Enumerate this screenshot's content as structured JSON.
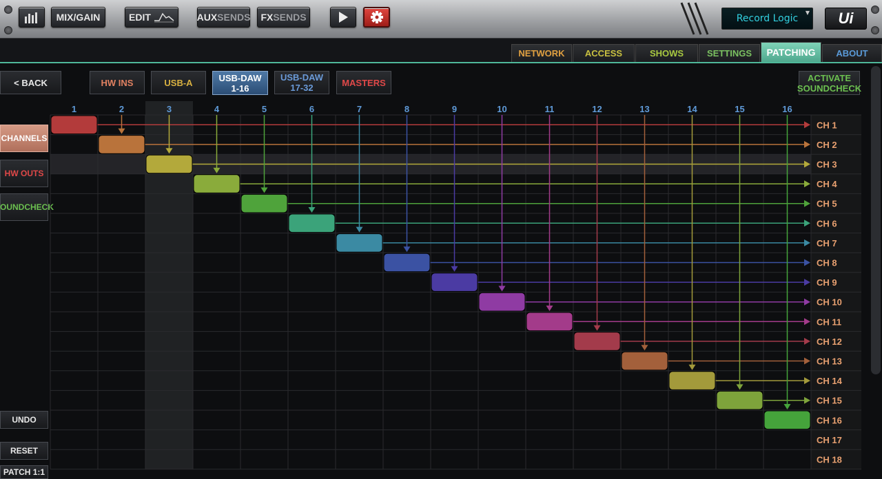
{
  "toolbar": {
    "meters_icon": "bar-meter-icon",
    "mixgain": "MIX/GAIN",
    "edit": "EDIT",
    "aux1": "AUX",
    "aux2": "SENDS",
    "fx1": "FX",
    "fx2": "SENDS",
    "play_icon": "play-icon",
    "settings_icon": "gear-icon",
    "display": "Record Logic",
    "logo": "Ui"
  },
  "tabs": [
    {
      "label": "NETWORK",
      "color": "#e0a040"
    },
    {
      "label": "ACCESS",
      "color": "#c8c040"
    },
    {
      "label": "SHOWS",
      "color": "#a8c840"
    },
    {
      "label": "SETTINGS",
      "color": "#7ac060"
    },
    {
      "label": "PATCHING",
      "color": "#ffffff"
    },
    {
      "label": "ABOUT",
      "color": "#5a9ad8"
    }
  ],
  "sources": {
    "back": "< BACK",
    "hw_ins": "HW INS",
    "usb_a": "USB-A",
    "usb_daw_1": "USB-DAW",
    "usb_daw_1b": "1-16",
    "usb_daw_2": "USB-DAW",
    "usb_daw_2b": "17-32",
    "masters": "MASTERS",
    "activate1": "ACTIVATE",
    "activate2": "SOUNDCHECK"
  },
  "side": {
    "channels": "CHANNELS",
    "hw_outs": "HW OUTS",
    "soundcheck": "SOUNDCHECK",
    "undo": "UNDO",
    "reset": "RESET",
    "patch": "PATCH 1:1"
  },
  "columns": [
    "1",
    "2",
    "3",
    "4",
    "5",
    "6",
    "7",
    "8",
    "9",
    "10",
    "11",
    "12",
    "13",
    "14",
    "15",
    "16"
  ],
  "rows": [
    "CH 1",
    "CH 2",
    "CH 3",
    "CH 4",
    "CH 5",
    "CH 6",
    "CH 7",
    "CH 8",
    "CH 9",
    "CH 10",
    "CH 11",
    "CH 12",
    "CH 13",
    "CH 14",
    "CH 15",
    "CH 16",
    "CH 17",
    "CH 18"
  ],
  "patch_colors": [
    "#b33b3b",
    "#b9733b",
    "#b3a93b",
    "#8aab3b",
    "#4fa33b",
    "#3ba37a",
    "#3b8aa3",
    "#3b52a3",
    "#4b3ba3",
    "#8f3ba3",
    "#a33b8a",
    "#a33b4b",
    "#a3603b",
    "#a39a3b",
    "#7ea33b",
    "#45a33b"
  ],
  "selected_column": 3,
  "selected_row": 3
}
